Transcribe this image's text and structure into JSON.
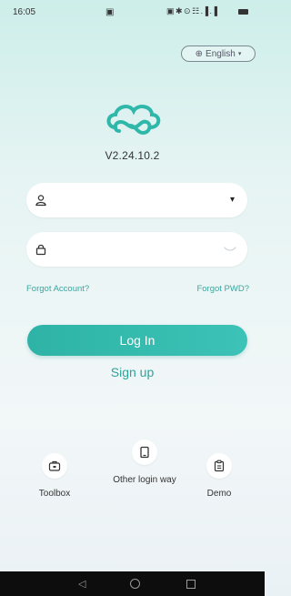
{
  "status_bar": {
    "time": "16:05",
    "notification": "▣",
    "system_icons": "▣ ✱ ⊙ ☷ .▐ .▐"
  },
  "language": {
    "label": "English",
    "caret": "▾",
    "globe": "⊕"
  },
  "app": {
    "version": "V2.24.10.2",
    "accent_color": "#2eb3a6"
  },
  "login_form": {
    "username": {
      "value": "",
      "placeholder": "",
      "dropdown_icon": "▾"
    },
    "password": {
      "value": "",
      "placeholder": ""
    },
    "forgot_account": "Forgot Account?",
    "forgot_pwd": "Forgot PWD?",
    "login_button": "Log In",
    "signup_link": "Sign up"
  },
  "tools": {
    "toolbox": "Toolbox",
    "other_login": "Other login way",
    "demo": "Demo"
  },
  "nav_bar": {
    "back": "◁"
  }
}
